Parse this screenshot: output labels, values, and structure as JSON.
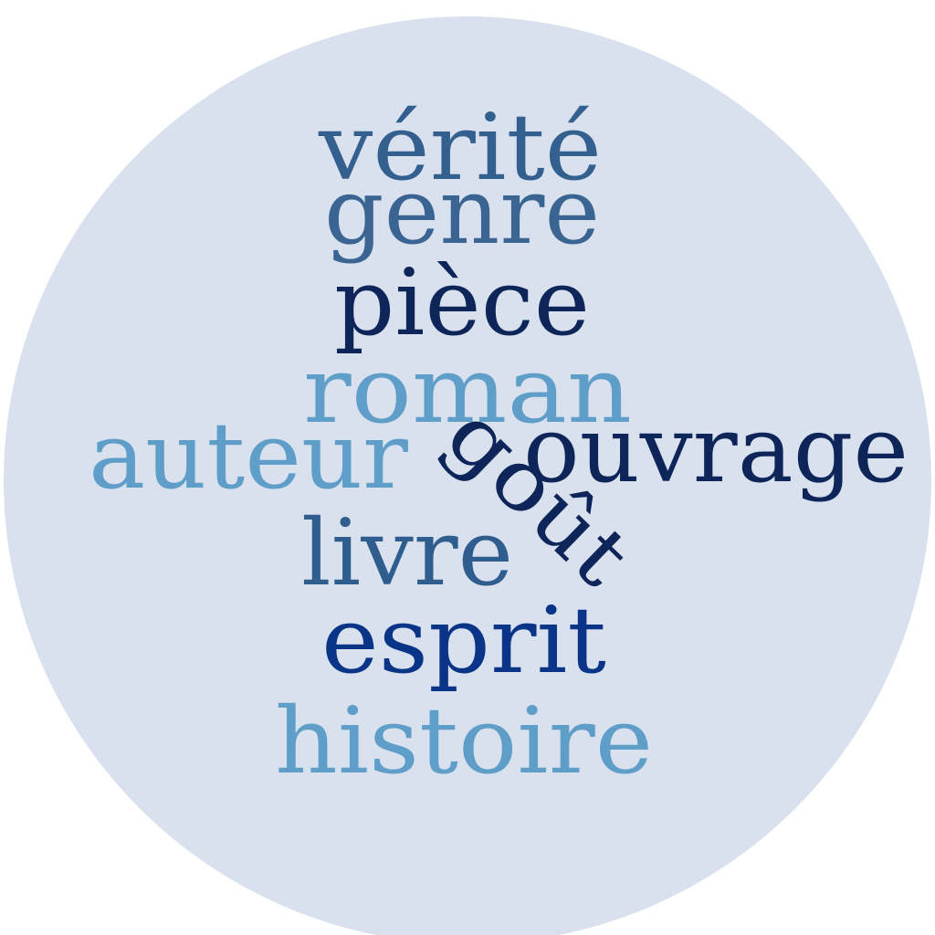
{
  "cloud": {
    "background_color": "#d9e1ee",
    "words": [
      {
        "text": "vérité",
        "color": "#34608f"
      },
      {
        "text": "genre",
        "color": "#3a6593"
      },
      {
        "text": "pièce",
        "color": "#0d2558"
      },
      {
        "text": "roman",
        "color": "#5f9ec8"
      },
      {
        "text": "auteur",
        "color": "#5f9ec8"
      },
      {
        "text": "goût",
        "color": "#0d2558"
      },
      {
        "text": "ouvrage",
        "color": "#0d2558"
      },
      {
        "text": "livre",
        "color": "#2f5e8e"
      },
      {
        "text": "esprit",
        "color": "#0a3487"
      },
      {
        "text": "histoire",
        "color": "#5f9ec8"
      }
    ]
  }
}
